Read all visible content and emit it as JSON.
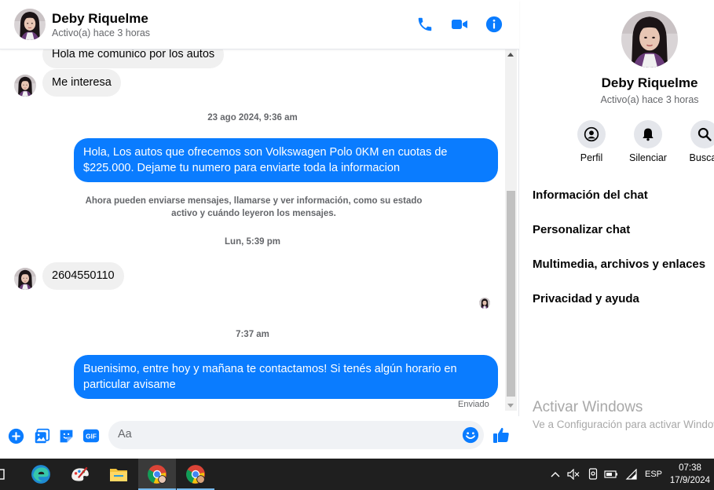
{
  "contact": {
    "name": "Deby Riquelme",
    "status": "Activo(a) hace 3 horas"
  },
  "messages": {
    "in_1": "Hola me comunico por los autos",
    "in_2": "Me interesa",
    "ts_1": "23 ago 2024, 9:36 am",
    "out_1": "Hola, Los autos que ofrecemos son Volkswagen Polo 0KM en cuotas de $225.000. Dejame tu numero para enviarte toda la informacion",
    "system_note": "Ahora pueden enviarse mensajes, llamarse y ver información, como su estado activo y cuándo leyeron los mensajes.",
    "ts_2": "Lun, 5:39 pm",
    "in_3": "2604550110",
    "ts_3": "7:37 am",
    "out_2": "Buenisimo, entre hoy y mañana te contactamos! Si tenés algún horario en particular avisame",
    "sent_label": "Enviado"
  },
  "composer": {
    "placeholder": "Aa",
    "gif_label": "GIF"
  },
  "info": {
    "actions": [
      {
        "label": "Perfil",
        "icon": "profile-icon"
      },
      {
        "label": "Silenciar",
        "icon": "bell-icon"
      },
      {
        "label": "Buscar",
        "icon": "search-icon"
      }
    ],
    "items": [
      "Información del chat",
      "Personalizar chat",
      "Multimedia, archivos y enlaces",
      "Privacidad y ayuda"
    ],
    "watermark_title": "Activar Windows",
    "watermark_sub": "Ve a Configuración para activar Windows."
  },
  "taskbar": {
    "lang": "ESP",
    "time": "07:38",
    "date": "17/9/2024"
  },
  "colors": {
    "accent": "#0a7cff",
    "incoming_bubble": "#f0f0f0",
    "taskbar": "#1f1f1f"
  }
}
